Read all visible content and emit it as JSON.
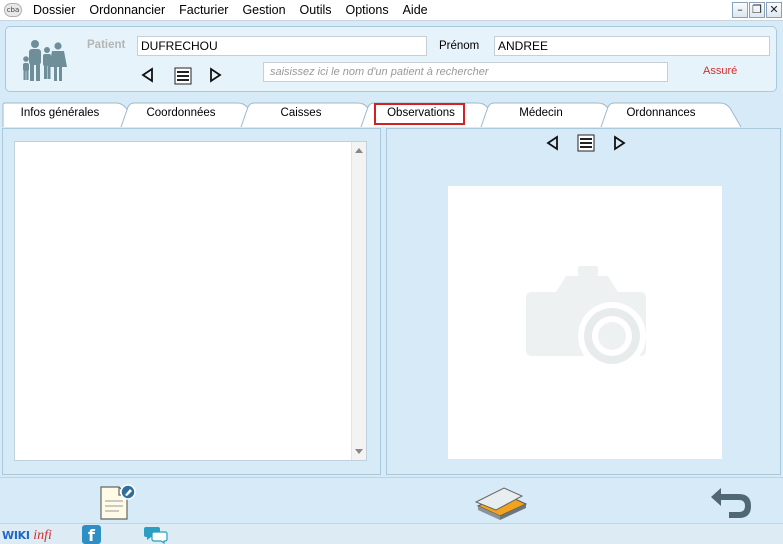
{
  "app": {
    "logo_text": "cba"
  },
  "menu": [
    "Dossier",
    "Ordonnancier",
    "Facturier",
    "Gestion",
    "Outils",
    "Options",
    "Aide"
  ],
  "window_controls": {
    "minimize": "–",
    "restore": "❐",
    "close": "✕"
  },
  "patient": {
    "label_patient": "Patient",
    "nom": "DUFRECHOU",
    "label_prenom": "Prénom",
    "prenom": "ANDREE",
    "search_placeholder": "saisissez ici le nom d'un patient à rechercher",
    "status": "Assuré",
    "status_color": "#d03030"
  },
  "tabs": [
    {
      "label": "Infos générales"
    },
    {
      "label": "Coordonnées"
    },
    {
      "label": "Caisses"
    },
    {
      "label": "Observations",
      "active": true
    },
    {
      "label": "Médecin"
    },
    {
      "label": "Ordonnances"
    }
  ],
  "observations": {
    "text": ""
  },
  "icons": {
    "family": "family-icon",
    "prev": "triangle-left-icon",
    "list": "list-icon",
    "next": "triangle-right-icon",
    "camera": "camera-placeholder-icon",
    "new_document": "document-edit-icon",
    "scanner": "scanner-icon",
    "back": "return-arrow-icon",
    "facebook": "facebook-icon",
    "chat": "chat-bubbles-icon"
  },
  "footer": {
    "wiki_part1": "WIKI",
    "wiki_part2": "infi",
    "facebook_glyph": "f"
  },
  "colors": {
    "background": "#d6ebf7",
    "panel": "#e6f3fa",
    "accent_red": "#d42020",
    "icon_teal": "#6e8e9a"
  }
}
